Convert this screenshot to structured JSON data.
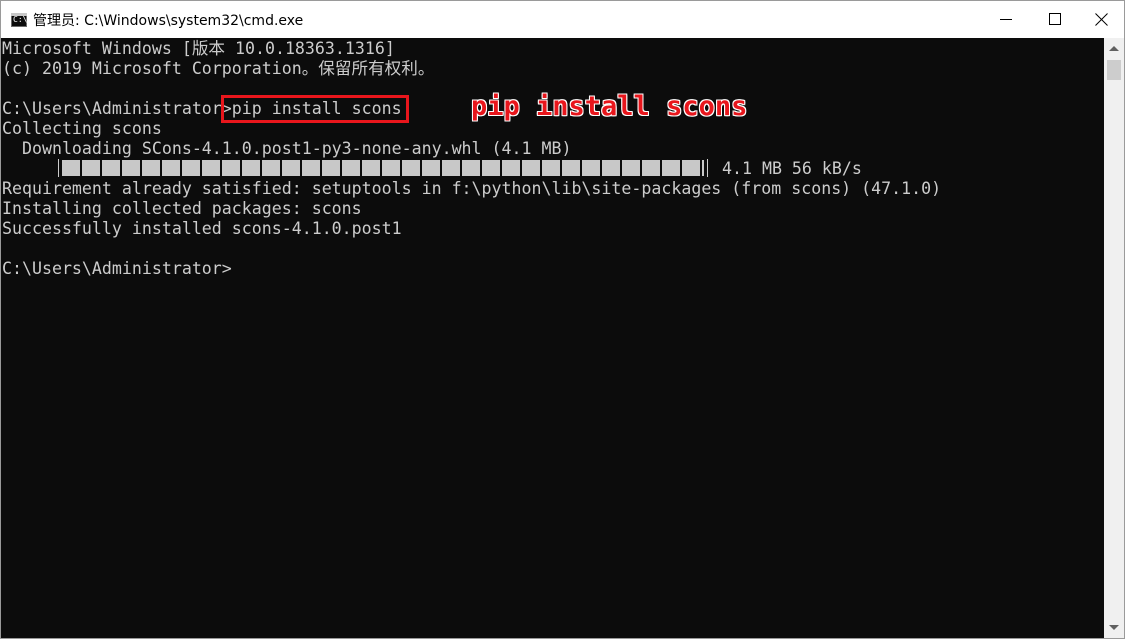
{
  "window": {
    "title": "管理员: C:\\Windows\\system32\\cmd.exe",
    "icon": "cmd-icon",
    "icon_text": "C:\\",
    "controls": [
      "minimize-icon",
      "maximize-icon",
      "close-icon"
    ]
  },
  "console": {
    "lines": [
      "Microsoft Windows [版本 10.0.18363.1316]",
      "(c) 2019 Microsoft Corporation。保留所有权利。",
      "",
      "C:\\Users\\Administrator>pip install scons",
      "Collecting scons",
      "  Downloading SCons-4.1.0.post1-py3-none-any.whl (4.1 MB)",
      "",
      "Requirement already satisfied: setuptools in f:\\python\\lib\\site-packages (from scons) (47.1.0)",
      "Installing collected packages: scons",
      "Successfully installed scons-4.1.0.post1",
      "",
      "C:\\Users\\Administrator>"
    ],
    "progress": {
      "percent": 100,
      "stats": "4.1 MB 56 kB/s"
    }
  },
  "annotation": {
    "text": "pip install scons",
    "color": "#e8161c"
  },
  "colors": {
    "console_bg": "#0c0c0c",
    "console_text": "#cccccc",
    "highlight": "#e8161c"
  }
}
